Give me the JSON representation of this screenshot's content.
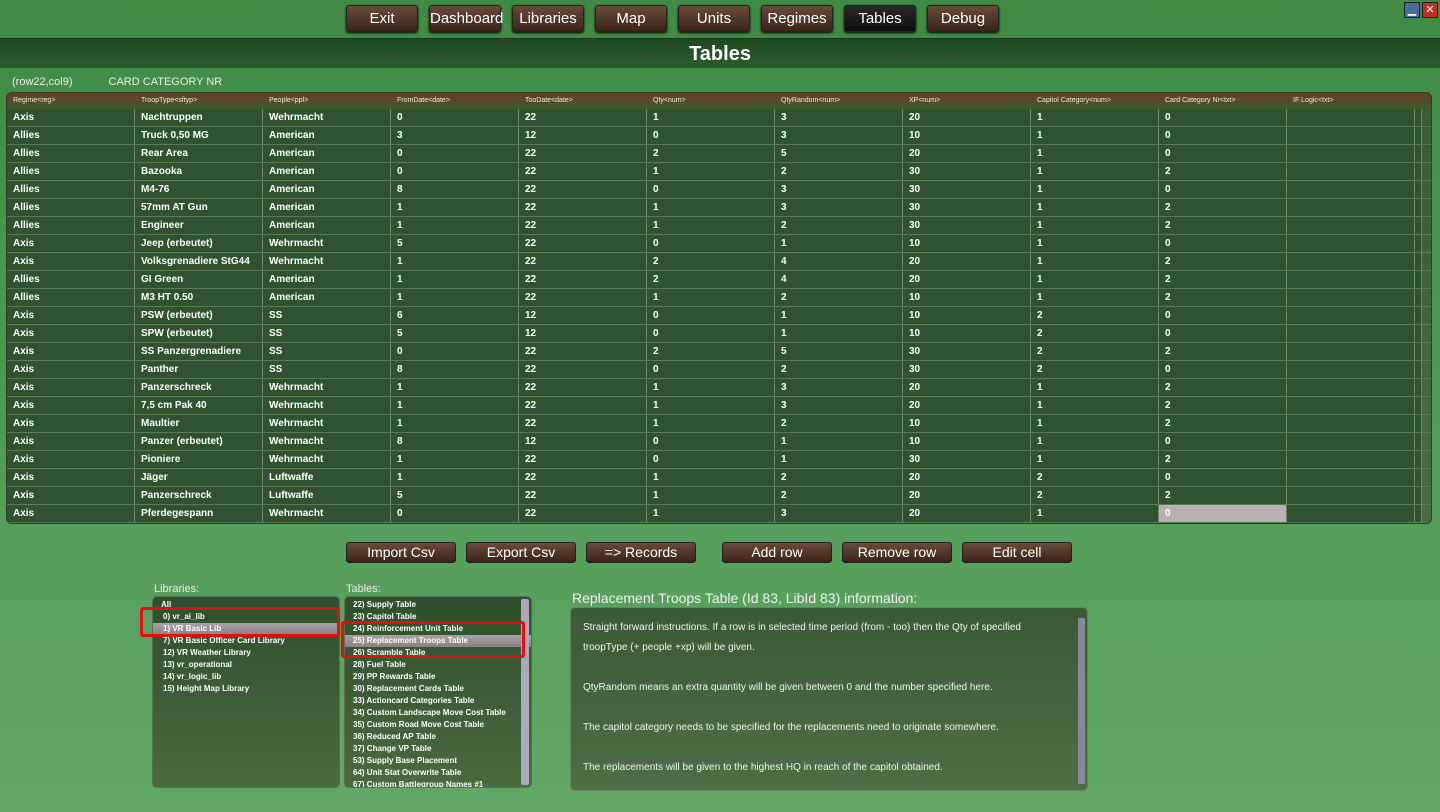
{
  "nav": [
    "Exit",
    "Dashboard",
    "Libraries",
    "Map",
    "Units",
    "Regimes",
    "Tables",
    "Debug"
  ],
  "active_nav": "Tables",
  "title": "Tables",
  "cell_pos": "(row22,col9)",
  "cell_col": "CARD CATEGORY NR",
  "columns": [
    "Regime<reg>",
    "TroopType<sftyp>",
    "People<ppl>",
    "FromDate<date>",
    "TooDate<date>",
    "Qty<num>",
    "QtyRandom<num>",
    "XP<num>",
    "Capitol Category<num>",
    "Card Category Nr<txt>",
    "IF Logic<txt>"
  ],
  "rows": [
    [
      "Axis",
      "Nachtruppen",
      "Wehrmacht",
      "0",
      "22",
      "1",
      "3",
      "20",
      "1",
      "0",
      ""
    ],
    [
      "Allies",
      "Truck 0,50 MG",
      "American",
      "3",
      "12",
      "0",
      "3",
      "10",
      "1",
      "0",
      ""
    ],
    [
      "Allies",
      "Rear Area",
      "American",
      "0",
      "22",
      "2",
      "5",
      "20",
      "1",
      "0",
      ""
    ],
    [
      "Allies",
      "Bazooka",
      "American",
      "0",
      "22",
      "1",
      "2",
      "30",
      "1",
      "2",
      ""
    ],
    [
      "Allies",
      "M4-76",
      "American",
      "8",
      "22",
      "0",
      "3",
      "30",
      "1",
      "0",
      ""
    ],
    [
      "Allies",
      "57mm AT Gun",
      "American",
      "1",
      "22",
      "1",
      "3",
      "30",
      "1",
      "2",
      ""
    ],
    [
      "Allies",
      "Engineer",
      "American",
      "1",
      "22",
      "1",
      "2",
      "30",
      "1",
      "2",
      ""
    ],
    [
      "Axis",
      "Jeep (erbeutet)",
      "Wehrmacht",
      "5",
      "22",
      "0",
      "1",
      "10",
      "1",
      "0",
      ""
    ],
    [
      "Axis",
      "Volksgrenadiere StG44",
      "Wehrmacht",
      "1",
      "22",
      "2",
      "4",
      "20",
      "1",
      "2",
      ""
    ],
    [
      "Allies",
      "GI Green",
      "American",
      "1",
      "22",
      "2",
      "4",
      "20",
      "1",
      "2",
      ""
    ],
    [
      "Allies",
      "M3 HT 0.50",
      "American",
      "1",
      "22",
      "1",
      "2",
      "10",
      "1",
      "2",
      ""
    ],
    [
      "Axis",
      "PSW (erbeutet)",
      "SS",
      "6",
      "12",
      "0",
      "1",
      "10",
      "2",
      "0",
      ""
    ],
    [
      "Axis",
      "SPW (erbeutet)",
      "SS",
      "5",
      "12",
      "0",
      "1",
      "10",
      "2",
      "0",
      ""
    ],
    [
      "Axis",
      "SS Panzergrenadiere",
      "SS",
      "0",
      "22",
      "2",
      "5",
      "30",
      "2",
      "2",
      ""
    ],
    [
      "Axis",
      "Panther",
      "SS",
      "8",
      "22",
      "0",
      "2",
      "30",
      "2",
      "0",
      ""
    ],
    [
      "Axis",
      "Panzerschreck",
      "Wehrmacht",
      "1",
      "22",
      "1",
      "3",
      "20",
      "1",
      "2",
      ""
    ],
    [
      "Axis",
      "7,5 cm Pak 40",
      "Wehrmacht",
      "1",
      "22",
      "1",
      "3",
      "20",
      "1",
      "2",
      ""
    ],
    [
      "Axis",
      "Maultier",
      "Wehrmacht",
      "1",
      "22",
      "1",
      "2",
      "10",
      "1",
      "2",
      ""
    ],
    [
      "Axis",
      "Panzer (erbeutet)",
      "Wehrmacht",
      "8",
      "12",
      "0",
      "1",
      "10",
      "1",
      "0",
      ""
    ],
    [
      "Axis",
      "Pioniere",
      "Wehrmacht",
      "1",
      "22",
      "0",
      "1",
      "30",
      "1",
      "2",
      ""
    ],
    [
      "Axis",
      "Jäger",
      "Luftwaffe",
      "1",
      "22",
      "1",
      "2",
      "20",
      "2",
      "0",
      ""
    ],
    [
      "Axis",
      "Panzerschreck",
      "Luftwaffe",
      "5",
      "22",
      "1",
      "2",
      "20",
      "2",
      "2",
      ""
    ],
    [
      "Axis",
      "Pferdegespann",
      "Wehrmacht",
      "0",
      "22",
      "1",
      "3",
      "20",
      "1",
      "0",
      ""
    ]
  ],
  "actions": [
    "Import Csv",
    "Export Csv",
    "=> Records",
    "Add row",
    "Remove row",
    "Edit cell"
  ],
  "libraries_label": "Libraries:",
  "libraries": [
    "All",
    "0) vr_ai_lib",
    "1) VR Basic Lib",
    "7) VR Basic Officer Card Library",
    "12) VR Weather Library",
    "13) vr_operational",
    "14) vr_logic_lib",
    "15) Height Map Library"
  ],
  "selected_library": "1) VR Basic Lib",
  "tables_label": "Tables:",
  "tables": [
    "22) Supply Table",
    "23) Capitol Table",
    "24) Reinforcement Unit Table",
    "25) Replacement Troops Table",
    "26) Scramble Table",
    "28) Fuel Table",
    "29) PP Rewards Table",
    "30) Replacement Cards Table",
    "33) Actioncard Categories Table",
    "34) Custom Landscape Move Cost Table",
    "35) Custom Road Move Cost Table",
    "36) Reduced AP Table",
    "37) Change VP Table",
    "53) Supply Base Placement",
    "64) Unit Stat Overwrite Table",
    "67) Custom Battlegroup Names #1"
  ],
  "selected_table": "25) Replacement Troops Table",
  "info_title": "Replacement Troops Table (Id 83, LibId 83) information:",
  "info": [
    "Straight forward instructions. If a row is in selected time period (from - too) then the Qty of specified troopType (+ people +xp) will be given.",
    "QtyRandom means an extra quantity will be given between 0 and the number specified here.",
    "The capitol category needs to be specified for the replacements need to originate somewhere.",
    "The replacements will be given to the highest HQ in reach of the capitol obtained."
  ]
}
